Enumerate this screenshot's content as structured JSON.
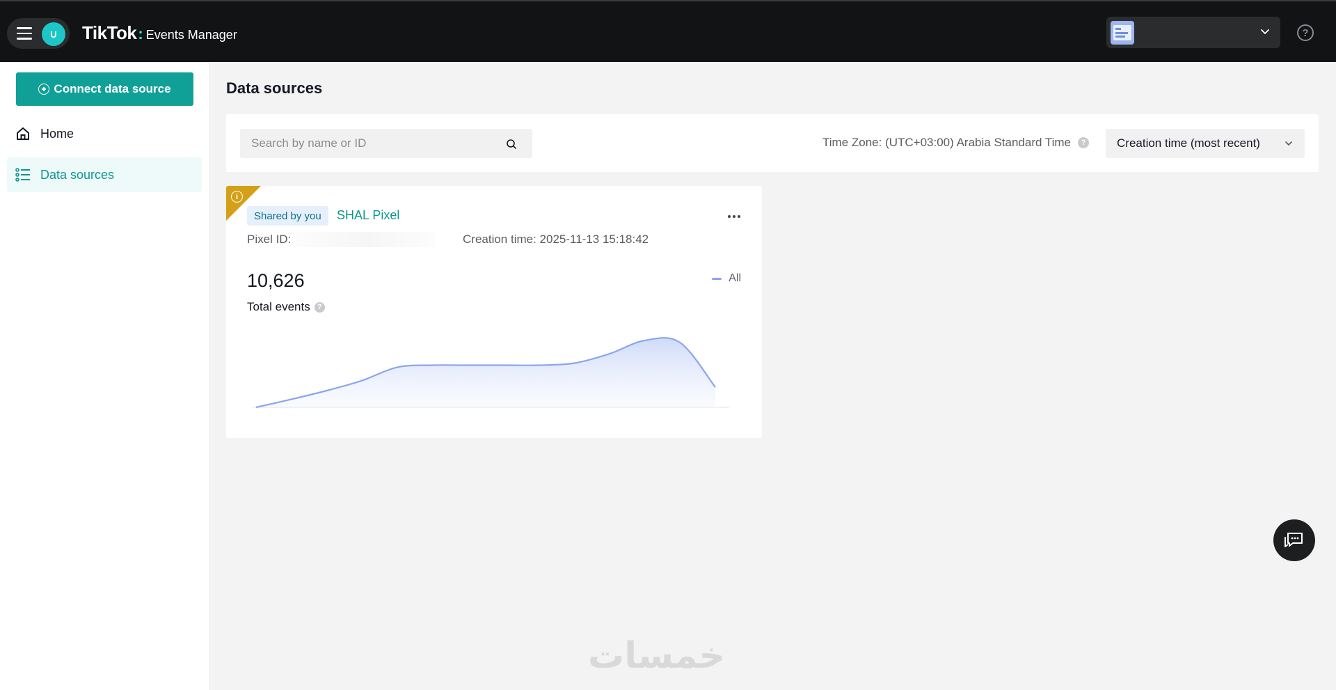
{
  "header": {
    "brand": "TikTok",
    "brand_separator": ":",
    "product": "Events Manager",
    "user_initial": "U",
    "account_name": ""
  },
  "sidebar": {
    "connect_button": "Connect data source",
    "items": [
      {
        "label": "Home",
        "icon": "home-icon",
        "active": false
      },
      {
        "label": "Data sources",
        "icon": "list-icon",
        "active": true
      }
    ]
  },
  "main": {
    "title": "Data sources",
    "search": {
      "placeholder": "Search by name or ID",
      "value": ""
    },
    "timezone": "Time Zone: (UTC+03:00) Arabia Standard Time",
    "sort": {
      "selected": "Creation time (most recent)"
    }
  },
  "card": {
    "tag": "Shared by you",
    "name": "SHAL Pixel",
    "pixel_id_label": "Pixel ID:",
    "creation_time": "Creation time: 2025-11-13 15:18:42",
    "total_value": "10,626",
    "total_label": "Total events",
    "legend": "All",
    "corner_badge_color": "#d4a017"
  },
  "chart_data": {
    "type": "area",
    "series": [
      {
        "name": "All",
        "values": [
          0,
          0.12,
          0.25,
          0.4,
          0.6,
          0.63,
          0.63,
          0.63,
          0.63,
          0.66,
          0.8,
          1.0,
          0.97,
          0.3
        ]
      }
    ],
    "title": "",
    "xlabel": "",
    "ylabel": ""
  },
  "watermark": "خمسات",
  "colors": {
    "accent": "#11a097",
    "topbar": "#121314",
    "chart_line": "#8aa6ec"
  }
}
